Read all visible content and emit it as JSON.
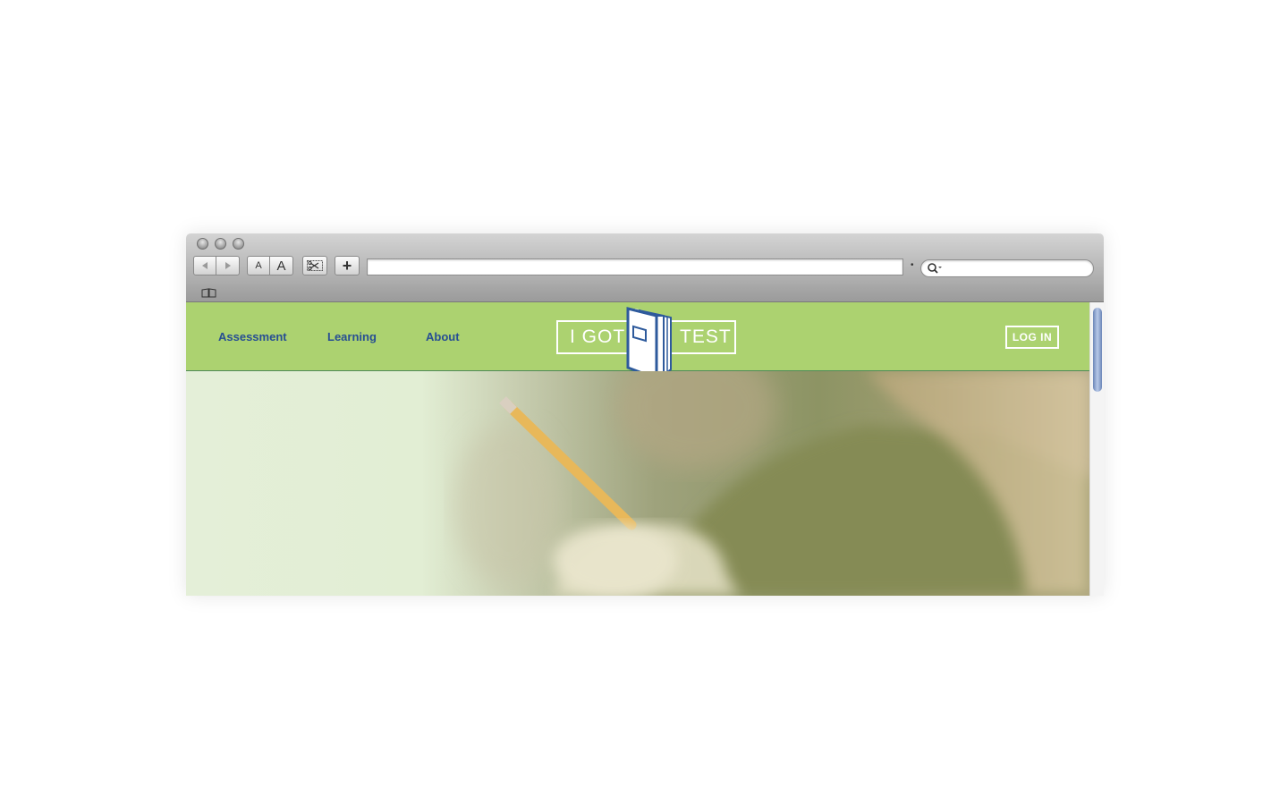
{
  "browser": {
    "url": "",
    "search_placeholder": "",
    "toolbar": {
      "back_icon": "triangle-left",
      "forward_icon": "triangle-right",
      "text_smaller": "A",
      "text_bigger": "A",
      "add_label": "+"
    }
  },
  "site": {
    "nav": {
      "items": [
        {
          "label": "Assessment"
        },
        {
          "label": "Learning"
        },
        {
          "label": "About"
        }
      ],
      "login_label": "LOG IN"
    },
    "logo": {
      "left_text": "I GOT",
      "right_text": "TEST"
    }
  },
  "colors": {
    "nav_background": "#acd270",
    "nav_link": "#274e93",
    "hero_tint": "#e4efd8"
  }
}
